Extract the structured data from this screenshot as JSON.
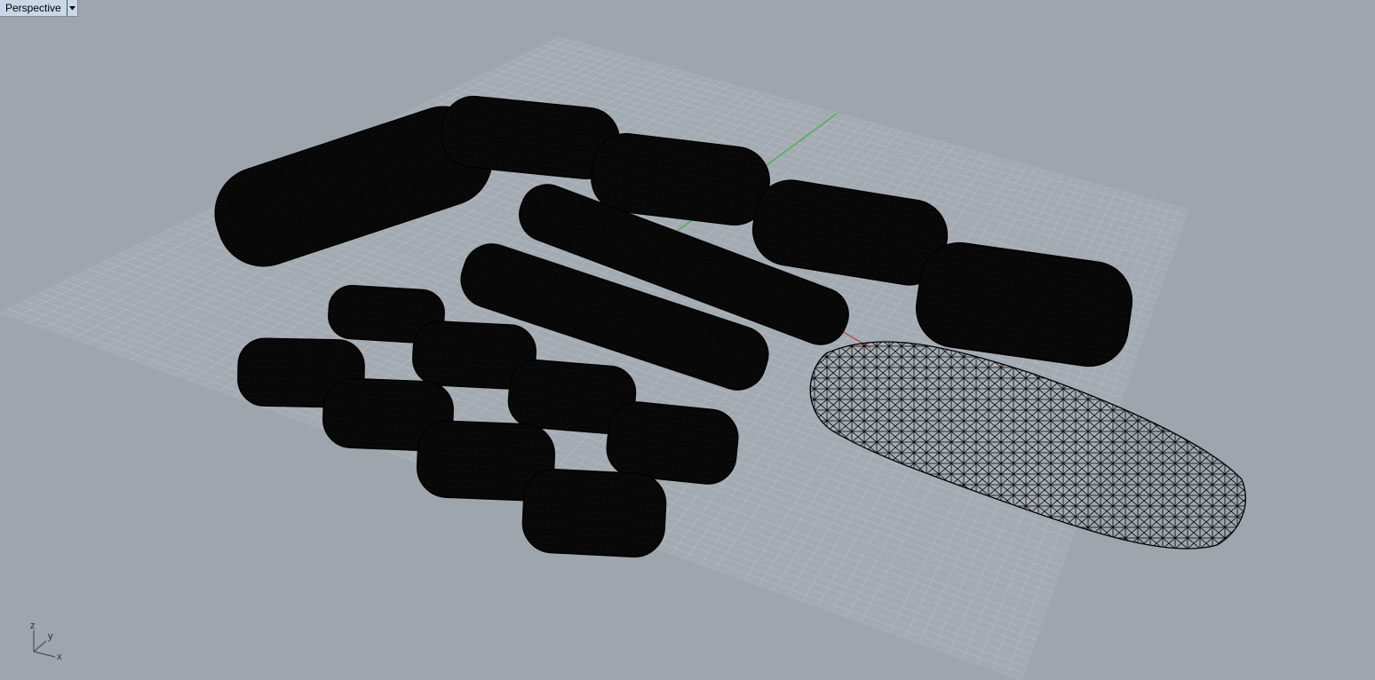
{
  "viewport": {
    "name": "Perspective",
    "background": "#9ea5ad",
    "grid_color": "#b8bec5",
    "grid_major_color": "#a9b0b8",
    "x_axis_color": "#c0392b",
    "y_axis_color": "#3fb34a",
    "mesh_color": "#000000"
  },
  "axis_widget": {
    "z": "z",
    "y": "y",
    "x": "x"
  },
  "tab": {
    "dropdown_icon": "triangle-down-icon"
  }
}
